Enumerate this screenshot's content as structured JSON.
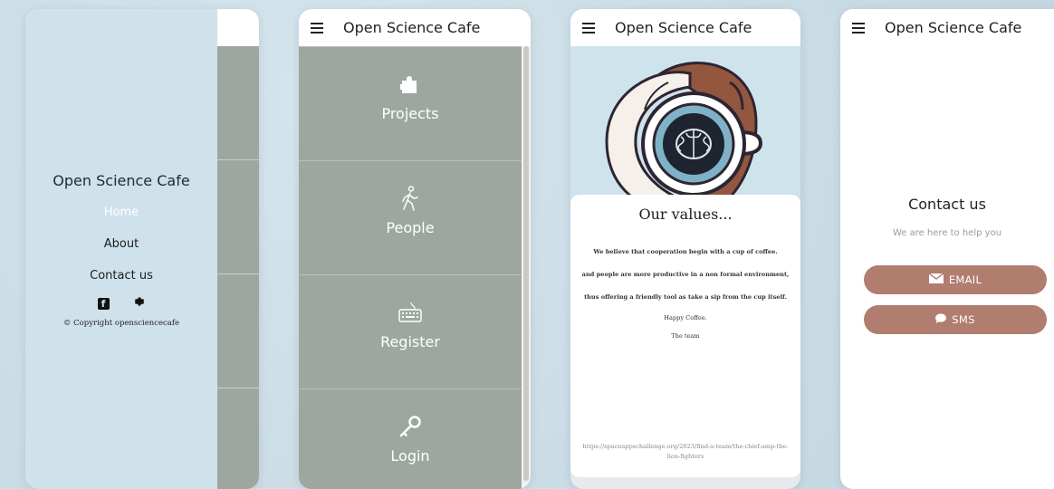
{
  "app": {
    "title": "Open Science Cafe"
  },
  "drawer": {
    "title": "Open Science Cafe",
    "nav": [
      {
        "label": "Home",
        "active": true
      },
      {
        "label": "About",
        "active": false
      },
      {
        "label": "Contact us",
        "active": false
      }
    ],
    "social_icons": [
      "facebook-icon",
      "gear-icon"
    ],
    "copyright": "© Copyright opensciencecafe"
  },
  "menu": {
    "tiles": [
      {
        "label": "Projects",
        "icon": "puzzle-icon"
      },
      {
        "label": "People",
        "icon": "walking-person-icon"
      },
      {
        "label": "Register",
        "icon": "keyboard-icon"
      },
      {
        "label": "Login",
        "icon": "key-icon"
      }
    ]
  },
  "values": {
    "heading": "Our values...",
    "lines": [
      "We believe that cooperation begin with a cup of coffee.",
      "and people are more productive in a non formal environment,",
      "thus offering a friendly tool as take a sip from the cup itself.",
      "Happy Coffee.",
      "The team"
    ],
    "link": "https://spaceappschallenge.org/2023/find-a-team/the-chief-amp-the-lion-fighters"
  },
  "contact": {
    "title": "Contact us",
    "subtitle": "We are here to help you",
    "email_label": "EMAIL",
    "sms_label": "SMS"
  },
  "colors": {
    "background": "#c9dbe5",
    "drawer": "#cfe1eb",
    "tile": "#9ea79f",
    "button": "#b07d6f"
  }
}
